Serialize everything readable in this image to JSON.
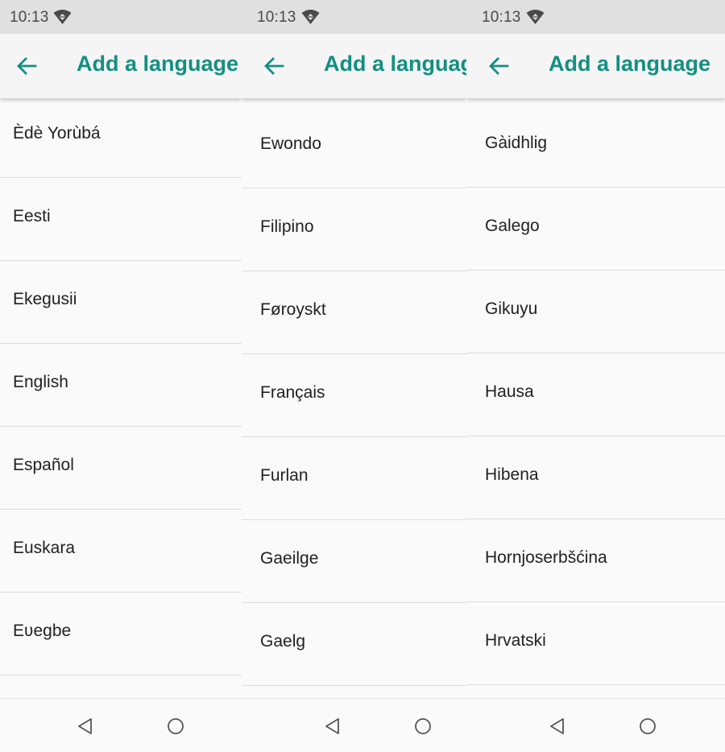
{
  "status": {
    "time": "10:13"
  },
  "appbar": {
    "title": "Add a language"
  },
  "panels": [
    {
      "items": [
        "Èdè Yorùbá",
        "Eesti",
        "Ekegusii",
        "English",
        "Español",
        "Euskara",
        "Eʋegbe"
      ]
    },
    {
      "items": [
        "Ewondo",
        "Filipino",
        "Føroyskt",
        "Français",
        "Furlan",
        "Gaeilge",
        "Gaelg"
      ]
    },
    {
      "items": [
        "Gàidhlig",
        "Galego",
        "Gikuyu",
        "Hausa",
        "Hibena",
        "Hornjoserbšćina",
        "Hrvatski"
      ]
    }
  ],
  "colors": {
    "accent": "#138f82",
    "statusbar": "#e0e0e0",
    "background": "#fafafa"
  },
  "icons": {
    "back": "arrow-left-icon",
    "wifi": "wifi-icon",
    "nav_back": "triangle-back-icon",
    "nav_home": "circle-home-icon"
  }
}
